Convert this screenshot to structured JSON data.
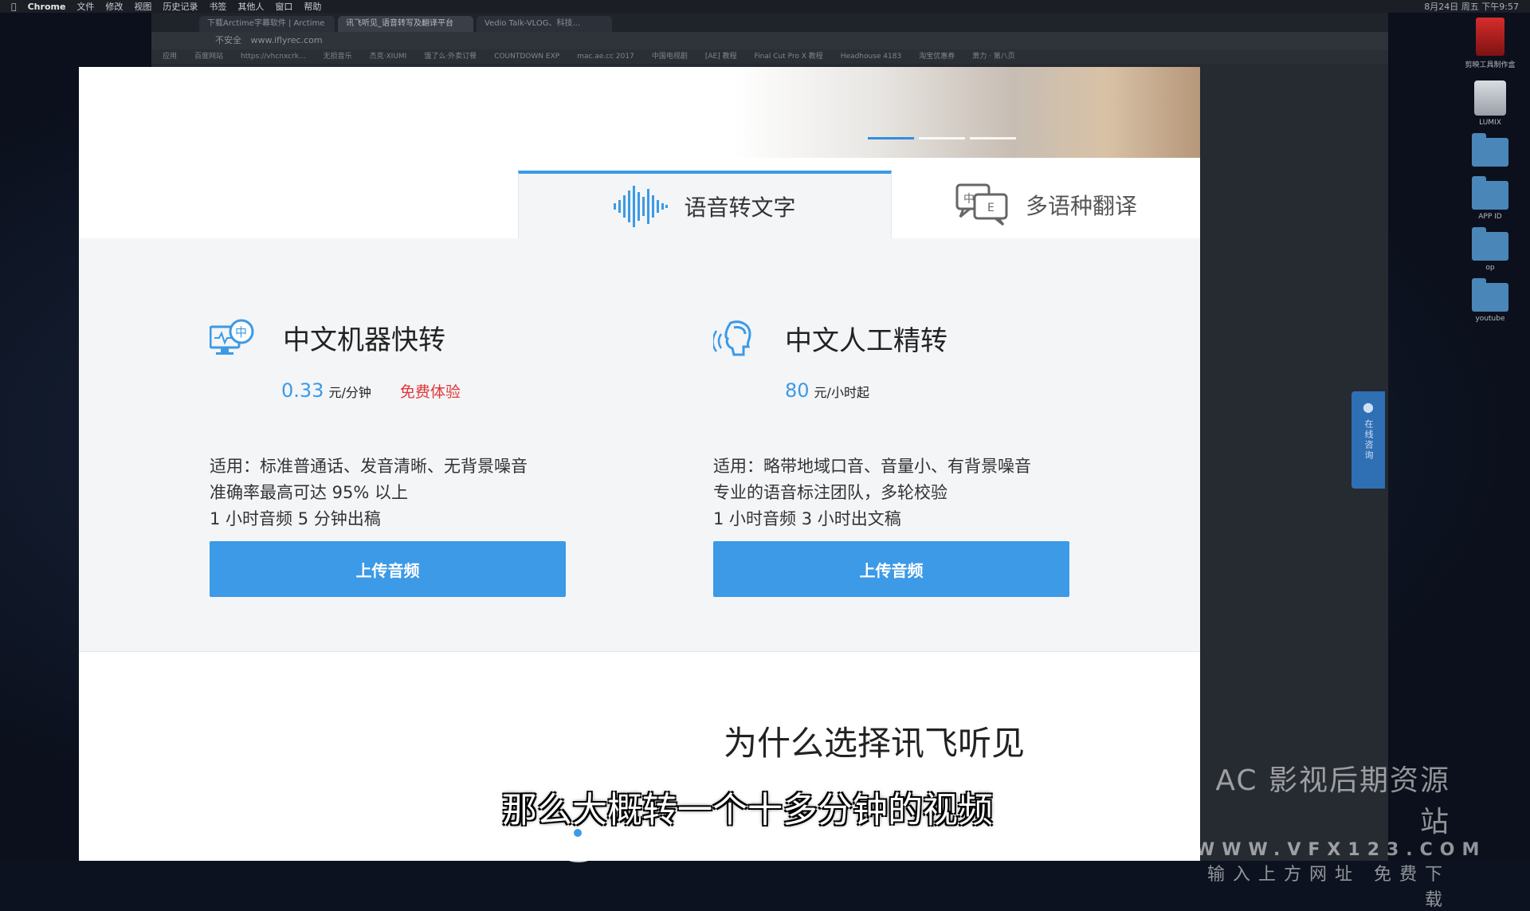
{
  "menubar": {
    "app": "Chrome",
    "items": [
      "文件",
      "修改",
      "视图",
      "历史记录",
      "书签",
      "其他人",
      "窗口",
      "帮助"
    ],
    "status": "8月24日 周五 下午9:57"
  },
  "browser": {
    "tabs": [
      "下载Arctime字幕软件 | Arctime",
      "讯飞听见_语音转写及翻译平台",
      "Vedio Talk-VLOG、科技..."
    ],
    "address": "www.iflyrec.com",
    "address_prefix": "不安全",
    "bookmarks": [
      "应用",
      "百度网站",
      "https://vhcnxcrk...",
      "无损音乐",
      "杰克·XIUMI",
      "饿了么·外卖订餐",
      "COUNTDOWN EXP",
      "mac.ae.cc 2017",
      "中国电视剧",
      "[AE] 教程",
      "Final Cut Pro X 教程",
      "Headhouse 4183",
      "淘宝优惠券",
      "萧力 · 第八页"
    ]
  },
  "desktop": {
    "icons": [
      {
        "label": "剪映工具制作盒",
        "kind": "app"
      },
      {
        "label": "LUMIX",
        "kind": "drive"
      },
      {
        "label": "",
        "kind": "folder"
      },
      {
        "label": "APP ID",
        "kind": "folder"
      },
      {
        "label": "op",
        "kind": "folder"
      },
      {
        "label": "youtube",
        "kind": "folder"
      }
    ]
  },
  "hero": {
    "carousel_active_index": 0,
    "carousel_count": 3
  },
  "tabs": {
    "active": {
      "label": "语音转文字",
      "icon": "sound-wave-icon"
    },
    "other": {
      "label": "多语种翻译",
      "icon": "translate-bubble-icon"
    }
  },
  "cards": [
    {
      "title": "中文机器快转",
      "icon": "monitor-zh-icon",
      "price_value": "0.33",
      "price_unit": "元/分钟",
      "free_label": "免费体验",
      "desc": [
        "适用：标准普通话、发音清晰、无背景噪音",
        "准确率最高可达 95% 以上",
        "1 小时音频 5 分钟出稿"
      ],
      "button": "上传音频"
    },
    {
      "title": "中文人工精转",
      "icon": "human-speaker-icon",
      "price_value": "80",
      "price_unit": "元/小时起",
      "free_label": "",
      "desc": [
        "适用：略带地域口音、音量小、有背景噪音",
        "专业的语音标注团队，多轮校验",
        "1 小时音频 3 小时出文稿"
      ],
      "button": "上传音频"
    }
  ],
  "why_heading": "为什么选择讯飞听见",
  "side_widget": {
    "label": "在线咨询"
  },
  "overlay": {
    "subtitle": "那么大概转一个十多分钟的视频",
    "watermark_line1": "AC 影视后期资源站",
    "watermark_line2": "WWW.VFX123.COM",
    "watermark_line3": "输入上方网址 免费下载"
  },
  "colors": {
    "accent": "#3c9ae6",
    "free": "#e0373a"
  }
}
